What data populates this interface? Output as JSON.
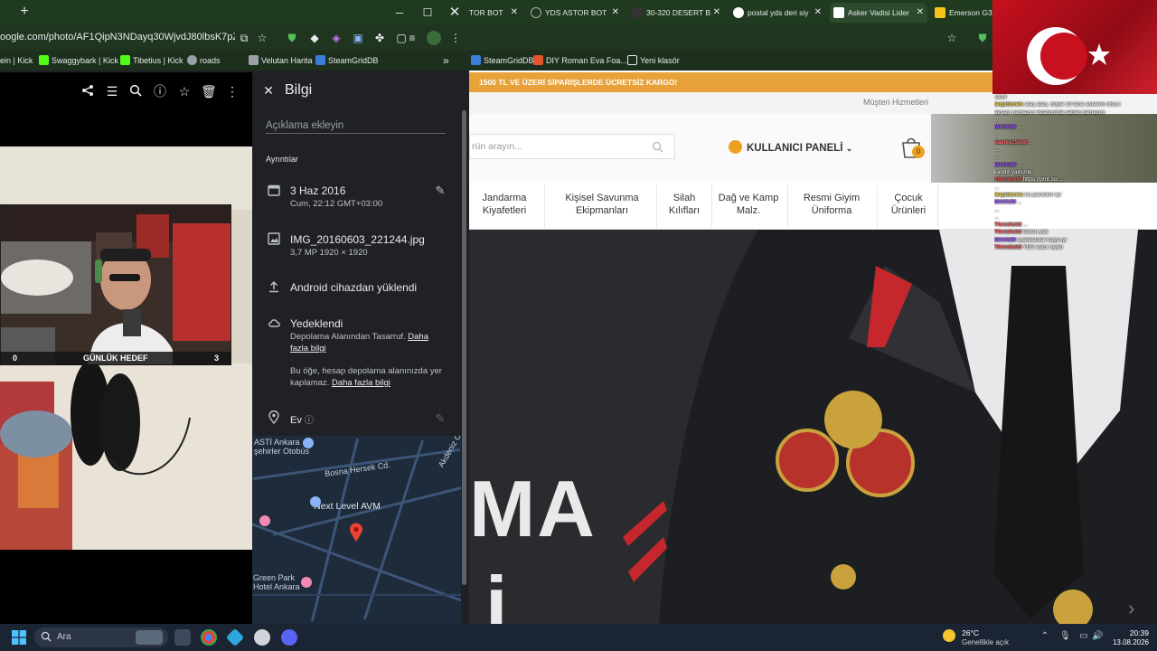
{
  "left_window": {
    "url": "oogle.com/photo/AF1QipN3NDayq30WjvdJ80lbsK7pZyiHLla...",
    "bookmarks": [
      {
        "label": "ein | Kick",
        "color": ""
      },
      {
        "label": "Swaggybark | Kick",
        "color": "#53fc18"
      },
      {
        "label": "Tibetius | Kick",
        "color": "#53fc18"
      },
      {
        "label": "roads",
        "color": "#9aa0a6"
      },
      {
        "label": "Velutan Harita",
        "color": "#9aa0a6"
      },
      {
        "label": "SteamGridDB",
        "color": "#3b7dd8"
      }
    ],
    "hedef": {
      "left": "0",
      "title": "GÜNLÜK HEDEF",
      "right": "3"
    }
  },
  "info": {
    "title": "Bilgi",
    "description_placeholder": "Açıklama ekleyin",
    "section": "Ayrıntılar",
    "date": "3 Haz 2016",
    "date_sub": "Cum, 22:12   GMT+03:00",
    "filename": "IMG_20160603_221244.jpg",
    "file_sub": "3,7 MP    1920 × 1920",
    "upload": "Android cihazdan yüklendi",
    "backup": "Yedeklendi",
    "backup_sub1": "Depolama Alanından Tasarruf.",
    "backup_link1": "Daha",
    "backup_sub1b": "fazla bilgi",
    "storage_sub1": "Bu öğe, hesap depolama alanınızda yer",
    "storage_sub2": "kaplamaz.",
    "storage_link": "Daha fazla bilgi",
    "location": "Ev",
    "map_labels": {
      "otobus": "ASTİ Ankara\nşehirler Otobüs",
      "bosna": "Bosna Hersek Cd.",
      "nextlevel": "Next Level AVM",
      "greenpark": "Green Park\nHotel Ankara",
      "akdeniz": "Akdeniz Cd."
    }
  },
  "tabs": [
    {
      "label": "TOR BOT",
      "color": "#888"
    },
    {
      "label": "YDS ASTOR BOT",
      "color": "#888"
    },
    {
      "label": "30-320 DESERT B",
      "color": "#333"
    },
    {
      "label": "postal yds deri siy",
      "color": "#4285f4"
    },
    {
      "label": "Asker Vadisi Lider",
      "color": "#fff"
    },
    {
      "label": "Emerson G3 Co",
      "color": "#f5c518"
    }
  ],
  "right_bookmarks": [
    {
      "label": "SteamGridDB",
      "color": "#3b7dd8"
    },
    {
      "label": "DIY Roman Eva Foa...",
      "color": "#e2542e"
    },
    {
      "label": "Yeni klasör",
      "color": ""
    }
  ],
  "shop": {
    "promo": "1500 TL VE ÜZERİ SİPARİŞLERDE ÜCRETSİZ KARGO!",
    "customer_service": "Müşteri Hizmetleri",
    "search_placeholder": "rün arayın...",
    "user_panel": "KULLANICI PANELİ",
    "cart_count": "0",
    "nav": [
      {
        "line1": "Jandarma",
        "line2": "Kiyafetleri"
      },
      {
        "line1": "Kişisel Savunma",
        "line2": "Ekipmanları"
      },
      {
        "line1": "Silah",
        "line2": "Kılıfları"
      },
      {
        "line1": "Dağ ve Kamp",
        "line2": "Malz."
      },
      {
        "line1": "Resmi Giyim",
        "line2": "Üniforma"
      },
      {
        "line1": "Çocuk",
        "line2": "Ürünleri"
      }
    ],
    "hero_text": "MA",
    "hero_text2": "i"
  },
  "chat": [
    {
      "user": "",
      "msg": "varol",
      "ucolor": "#fff"
    },
    {
      "user": "terpidoreis",
      "msg": "ateş ateş. böyle 10 tane askerim olsun",
      "ucolor": "#f5d742"
    },
    {
      "user": "",
      "msg": "akşam namazını İstanbul'da sabah namazını",
      "ucolor": "#fff"
    },
    {
      "user": "",
      "msg": "...",
      "ucolor": "#fff"
    },
    {
      "user": "MAHUM",
      "msg": "...",
      "ucolor": "#9b59ff"
    },
    {
      "user": "",
      "msg": "...",
      "ucolor": "#fff"
    },
    {
      "user": "kaafea15000",
      "msg": "...",
      "ucolor": "#ff6b6b"
    },
    {
      "user": "",
      "msg": "...",
      "ucolor": "#fff"
    },
    {
      "user": "",
      "msg": "...",
      "ucolor": "#fff"
    },
    {
      "user": "MAHUM",
      "msg": "...",
      "ucolor": "#9b59ff"
    },
    {
      "user": "",
      "msg": "kandır yalnızlık",
      "ucolor": "#fff"
    },
    {
      "user": "Threshold",
      "msg": "https://prnt.sc/...",
      "ucolor": "#ff5c5c"
    },
    {
      "user": "",
      "msg": "...",
      "ucolor": "#fff"
    },
    {
      "user": "terpidoreis",
      "msg": "bu pantolon iyi",
      "ucolor": "#f5d742"
    },
    {
      "user": "MAHUM",
      "msg": "...",
      "ucolor": "#9b59ff"
    },
    {
      "user": "",
      "msg": "...",
      "ucolor": "#fff"
    },
    {
      "user": "",
      "msg": "...",
      "ucolor": "#fff"
    },
    {
      "user": "Threshold",
      "msg": "...",
      "ucolor": "#ff5c5c"
    },
    {
      "user": "Threshold",
      "msg": "Sorun yok",
      "ucolor": "#ff5c5c"
    },
    {
      "user": "MAHUM",
      "msg": "ayakkabılar baya iyi",
      "ucolor": "#9b59ff"
    },
    {
      "user": "Threshold",
      "msg": "YDS astor siyah",
      "ucolor": "#ff5c5c"
    }
  ],
  "taskbar": {
    "search": "Ara",
    "weather_temp": "26°C",
    "weather_desc": "Genellikle açık",
    "time": "20:39",
    "date": "13.08.2026"
  },
  "icons": [
    "share-icon",
    "adjust-icon",
    "zoom-icon",
    "info-icon",
    "star-icon",
    "trash-icon",
    "more-icon",
    "close-icon",
    "calendar-icon",
    "image-icon",
    "upload-icon",
    "cloud-icon",
    "location-icon",
    "edit-icon",
    "search-icon",
    "user-icon",
    "cart-icon",
    "windows-icon"
  ]
}
